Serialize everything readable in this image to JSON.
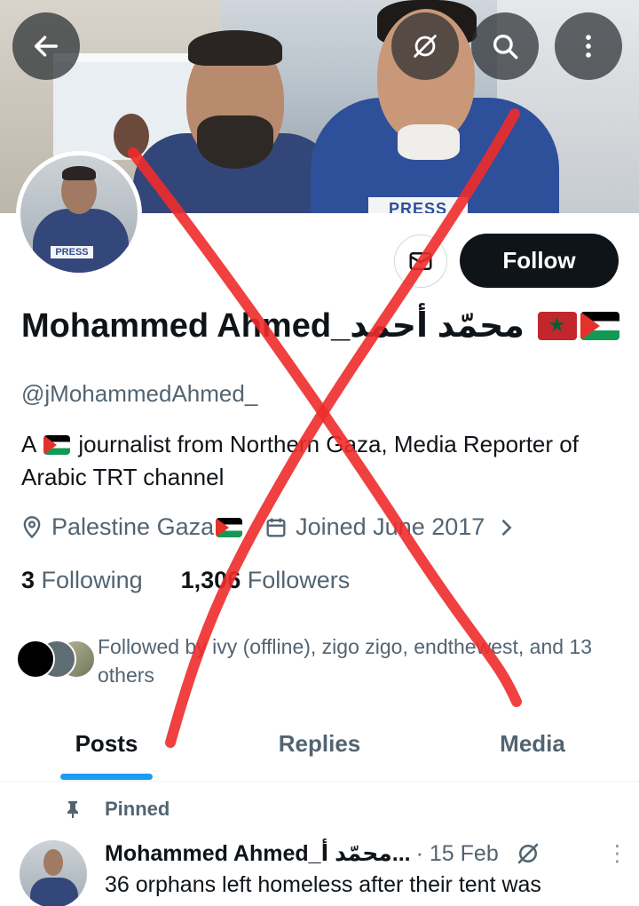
{
  "profile": {
    "display_name": "Mohammed Ahmed_محمّد أحمد",
    "handle": "@jMohammedAhmed_",
    "bio_prefix": "A",
    "bio_rest": "journalist from Northern Gaza, Media Reporter of Arabic TRT channel",
    "location": "Palestine Gaza",
    "joined": "Joined June 2017",
    "following_count": "3",
    "following_label": "Following",
    "followers_count": "1,306",
    "followers_label": "Followers",
    "followed_by": "Followed by ivy (offline), zigo zigo, endthewest, and 13 others",
    "banner_press_text": "PRESS",
    "avatar_press_text": "PRESS"
  },
  "actions": {
    "follow_label": "Follow"
  },
  "tabs": [
    {
      "label": "Posts",
      "active": true
    },
    {
      "label": "Replies",
      "active": false
    },
    {
      "label": "Media",
      "active": false
    }
  ],
  "pinned_post": {
    "pinned_label": "Pinned",
    "author": "Mohammed Ahmed_محمّد أ...",
    "date": "· 15 Feb",
    "text": "36 orphans left homeless after their tent was",
    "more": "⋮"
  },
  "icons": {
    "back": "arrow-left-icon",
    "grok": "grok-icon",
    "search": "search-icon",
    "more": "more-vertical-icon",
    "message": "mail-icon",
    "location": "location-pin-icon",
    "calendar": "calendar-icon",
    "chevron": "chevron-right-icon",
    "pin": "pin-icon"
  },
  "colors": {
    "accent": "#1d9bf0",
    "text_primary": "#0f1419",
    "text_secondary": "#536471",
    "follow_button_bg": "#0f1419",
    "overlay_x": "#ee2b2b"
  }
}
